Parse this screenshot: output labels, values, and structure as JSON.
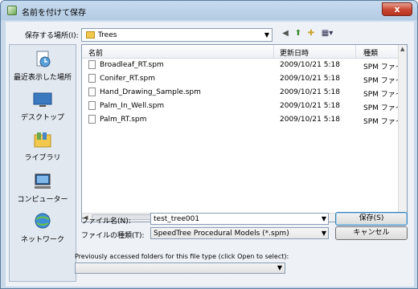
{
  "window": {
    "title": "名前を付けて保存",
    "close": "x"
  },
  "savein": {
    "label": "保存する場所(I):",
    "folder": "Trees"
  },
  "toolbar": {
    "back": "◀",
    "up": "⬆",
    "newfolder": "✚",
    "view": "▦▾"
  },
  "places": [
    {
      "label": "最近表示した場所"
    },
    {
      "label": "デスクトップ"
    },
    {
      "label": "ライブラリ"
    },
    {
      "label": "コンピューター"
    },
    {
      "label": "ネットワーク"
    }
  ],
  "columns": {
    "name": "名前",
    "date": "更新日時",
    "type": "種類"
  },
  "files": [
    {
      "name": "Broadleaf_RT.spm",
      "date": "2009/10/21 5:18",
      "type": "SPM ファイル"
    },
    {
      "name": "Conifer_RT.spm",
      "date": "2009/10/21 5:18",
      "type": "SPM ファイル"
    },
    {
      "name": "Hand_Drawing_Sample.spm",
      "date": "2009/10/21 5:18",
      "type": "SPM ファイル"
    },
    {
      "name": "Palm_In_Well.spm",
      "date": "2009/10/21 5:18",
      "type": "SPM ファイル"
    },
    {
      "name": "Palm_RT.spm",
      "date": "2009/10/21 5:18",
      "type": "SPM ファイル"
    }
  ],
  "filename": {
    "label": "ファイル名(N):",
    "value": "test_tree001"
  },
  "filetype": {
    "label": "ファイルの種類(T):",
    "value": "SpeedTree Procedural Models (*.spm)"
  },
  "buttons": {
    "save": "保存(S)",
    "cancel": "キャンセル"
  },
  "previous": {
    "label": "Previously accessed folders for this file type (click Open to select):",
    "value": ""
  },
  "colors": {
    "accent": "#3c7fb1",
    "titlebar": "#c7dbef",
    "close": "#c9452f"
  }
}
